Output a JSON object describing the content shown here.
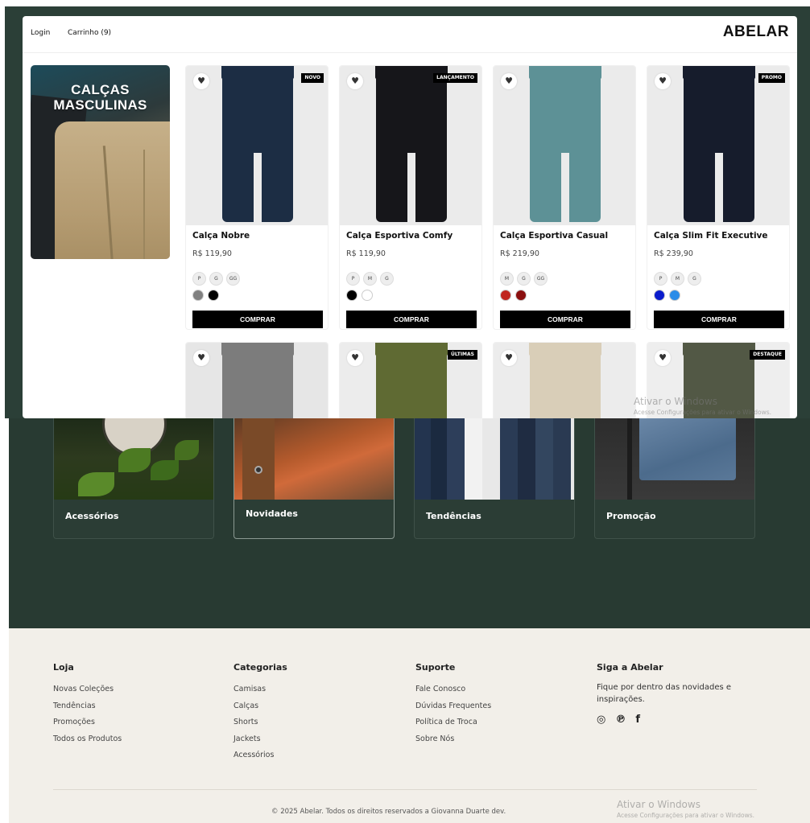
{
  "store": {
    "nav": {
      "login": "Login",
      "cart": "Carrinho (9)"
    },
    "brand": "ABELAR",
    "banner": {
      "title_line1": "CALÇAS",
      "title_line2": "MASCULINAS"
    },
    "products": [
      {
        "name": "Calça Nobre",
        "price": "R$ 119,90",
        "badge": "NOVO",
        "sizes": [
          "P",
          "G",
          "GG"
        ],
        "colors": [
          "#808080",
          "#000000"
        ],
        "pants_color": "#1c2d44"
      },
      {
        "name": "Calça Esportiva Comfy",
        "price": "R$ 119,90",
        "badge": "LANÇAMENTO",
        "sizes": [
          "P",
          "M",
          "G"
        ],
        "colors": [
          "#000000",
          "#ffffff"
        ],
        "pants_color": "#16161a"
      },
      {
        "name": "Calça Esportiva Casual",
        "price": "R$ 219,90",
        "badge": "",
        "sizes": [
          "M",
          "G",
          "GG"
        ],
        "colors": [
          "#c0261f",
          "#8b0f0f"
        ],
        "pants_color": "#5d9196"
      },
      {
        "name": "Calça Slim Fit Executive",
        "price": "R$ 239,90",
        "badge": "PROMO",
        "sizes": [
          "P",
          "M",
          "G"
        ],
        "colors": [
          "#0a1ccc",
          "#2a8ce8"
        ],
        "pants_color": "#161c2c"
      }
    ],
    "row2": [
      {
        "badge": "",
        "pants_color": "#7c7c7c",
        "bg": "#e6e6e6"
      },
      {
        "badge": "ÚLTIMAS",
        "pants_color": "#5f6a33",
        "bg": "#ececec"
      },
      {
        "badge": "",
        "pants_color": "#d9ceb8",
        "bg": "#ececec"
      },
      {
        "badge": "DESTAQUE",
        "pants_color": "#525845",
        "bg": "#eeeeee"
      }
    ],
    "buy_label": "COMPRAR",
    "heart_icon": "♥"
  },
  "windows_watermark_top": {
    "title": "Ativar o Windows",
    "subtitle": "Acesse Configurações para ativar o Windows."
  },
  "categories": [
    {
      "label": "Acessórios"
    },
    {
      "label": "Novidades"
    },
    {
      "label": "Tendências"
    },
    {
      "label": "Promoção"
    }
  ],
  "footer": {
    "cols": [
      {
        "title": "Loja",
        "links": [
          "Novas Coleções",
          "Tendências",
          "Promoções",
          "Todos os Produtos"
        ]
      },
      {
        "title": "Categorias",
        "links": [
          "Camisas",
          "Calças",
          "Shorts",
          "Jackets",
          "Acessórios"
        ]
      },
      {
        "title": "Suporte",
        "links": [
          "Fale Conosco",
          "Dúvidas Frequentes",
          "Política de Troca",
          "Sobre Nós"
        ]
      }
    ],
    "follow": {
      "title": "Siga a Abelar",
      "text": "Fique por dentro das novidades e inspirações.",
      "icons": {
        "instagram": "◎",
        "pinterest": "℗",
        "facebook": "f"
      }
    },
    "copyright": "© 2025 Abelar. Todos os direitos reservados a Giovanna Duarte dev."
  },
  "windows_watermark_bottom": {
    "title": "Ativar o Windows",
    "subtitle": "Acesse Configurações para ativar o Windows."
  }
}
